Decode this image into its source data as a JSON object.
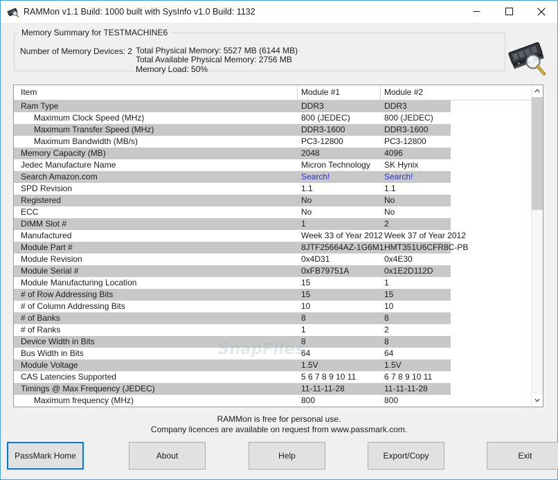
{
  "window": {
    "title": "RAMMon v1.1 Build: 1000 built with SysInfo v1.0 Build: 1132",
    "icon": "ram-module-magnifier-icon",
    "accent_color": "#0078d7",
    "border_color": "#4d9fd0",
    "controls": {
      "minimize": "minimize-icon",
      "maximize": "maximize-icon",
      "close": "close-icon"
    }
  },
  "summary": {
    "legend": "Memory Summary for TESTMACHINE6",
    "devices": "Number of Memory Devices: 2",
    "lines": [
      "Total Physical Memory: 5527 MB (6144 MB)",
      "Total Available Physical Memory: 2756 MB",
      "Memory Load: 50%"
    ],
    "icon": "ram-module-magnifier-icon"
  },
  "table": {
    "headers": [
      "Item",
      "Module #1",
      "Module #2"
    ],
    "watermark": "SnapFiles",
    "rows": [
      {
        "item": "Ram Type",
        "indent": false,
        "m1": "DDR3",
        "m2": "DDR3"
      },
      {
        "item": "Maximum Clock Speed (MHz)",
        "indent": true,
        "m1": "800 (JEDEC)",
        "m2": "800 (JEDEC)"
      },
      {
        "item": "Maximum Transfer Speed (MHz)",
        "indent": true,
        "m1": "DDR3-1600",
        "m2": "DDR3-1600"
      },
      {
        "item": "Maximum Bandwidth (MB/s)",
        "indent": true,
        "m1": "PC3-12800",
        "m2": "PC3-12800"
      },
      {
        "item": "Memory Capacity (MB)",
        "indent": false,
        "m1": "2048",
        "m2": "4096"
      },
      {
        "item": "Jedec Manufacture Name",
        "indent": false,
        "m1": "Micron Technology",
        "m2": "SK Hynix"
      },
      {
        "item": "Search Amazon.com",
        "indent": false,
        "m1": "Search!",
        "m2": "Search!",
        "link": true
      },
      {
        "item": "SPD Revision",
        "indent": false,
        "m1": "1.1",
        "m2": "1.1"
      },
      {
        "item": "Registered",
        "indent": false,
        "m1": "No",
        "m2": "No"
      },
      {
        "item": "ECC",
        "indent": false,
        "m1": "No",
        "m2": "No"
      },
      {
        "item": "DIMM Slot #",
        "indent": false,
        "m1": "1",
        "m2": "2"
      },
      {
        "item": "Manufactured",
        "indent": false,
        "m1": "Week 33 of Year 2012",
        "m2": "Week 37 of Year 2012"
      },
      {
        "item": "Module Part #",
        "indent": false,
        "m1": "8JTF25664AZ-1G6M1",
        "m2": "HMT351U6CFR8C-PB"
      },
      {
        "item": "Module Revision",
        "indent": false,
        "m1": "0x4D31",
        "m2": "0x4E30"
      },
      {
        "item": "Module Serial #",
        "indent": false,
        "m1": "0xFB79751A",
        "m2": "0x1E2D112D"
      },
      {
        "item": "Module Manufacturing Location",
        "indent": false,
        "m1": "15",
        "m2": "1"
      },
      {
        "item": "# of Row Addressing Bits",
        "indent": false,
        "m1": "15",
        "m2": "15"
      },
      {
        "item": "# of Column Addressing Bits",
        "indent": false,
        "m1": "10",
        "m2": "10"
      },
      {
        "item": "# of Banks",
        "indent": false,
        "m1": "8",
        "m2": "8"
      },
      {
        "item": "# of Ranks",
        "indent": false,
        "m1": "1",
        "m2": "2"
      },
      {
        "item": "Device Width in Bits",
        "indent": false,
        "m1": "8",
        "m2": "8"
      },
      {
        "item": "Bus Width in Bits",
        "indent": false,
        "m1": "64",
        "m2": "64"
      },
      {
        "item": "Module Voltage",
        "indent": false,
        "m1": "1.5V",
        "m2": "1.5V"
      },
      {
        "item": "CAS Latencies Supported",
        "indent": false,
        "m1": "5 6 7 8 9 10 11",
        "m2": "6 7 8 9 10 11"
      },
      {
        "item": "Timings @ Max Frequency (JEDEC)",
        "indent": false,
        "m1": "11-11-11-28",
        "m2": "11-11-11-28"
      },
      {
        "item": "Maximum frequency (MHz)",
        "indent": true,
        "m1": "800",
        "m2": "800"
      }
    ]
  },
  "scrollbar": {
    "up": "chevron-up-icon",
    "down": "chevron-down-icon"
  },
  "footer": {
    "line1": "RAMMon is free for personal use.",
    "line2": "Company licences are available on request from www.passmark.com."
  },
  "buttons": {
    "home": "PassMark Home",
    "about": "About",
    "help": "Help",
    "export": "Export/Copy",
    "exit": "Exit"
  }
}
